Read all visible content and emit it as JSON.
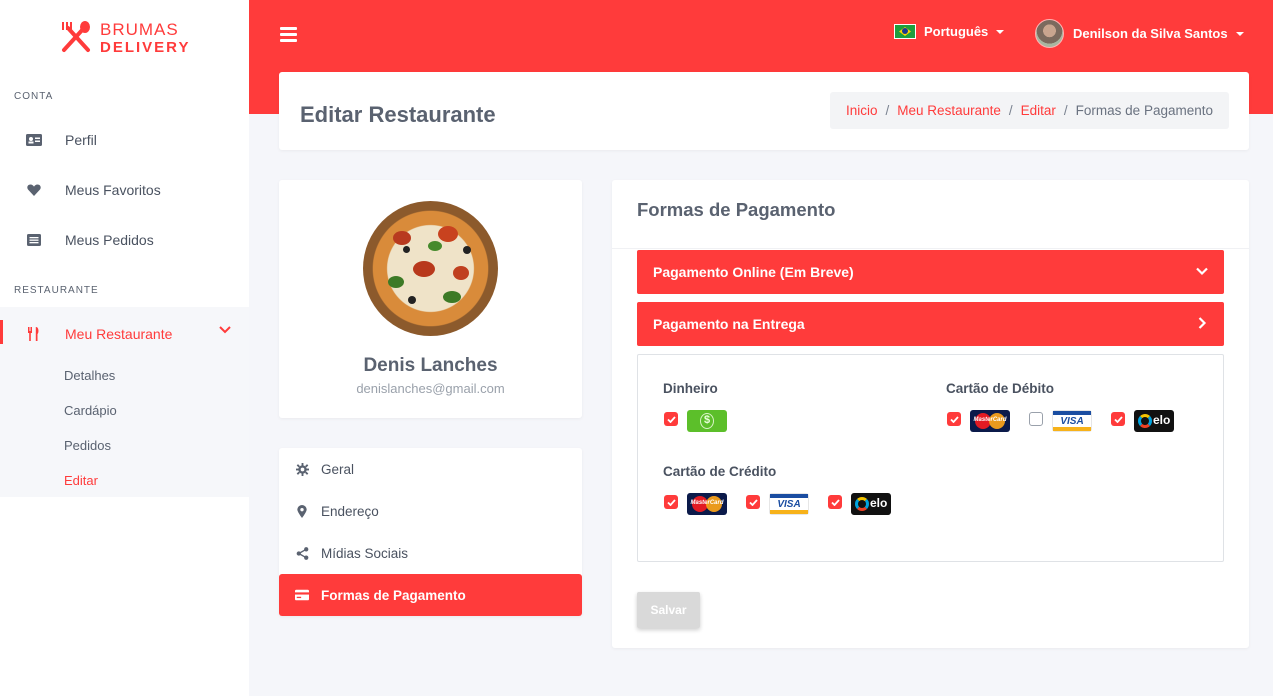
{
  "brand": {
    "line1": "BRUMAS",
    "line2": "DELIVERY"
  },
  "sidebar": {
    "section_account": "CONTA",
    "section_restaurant": "RESTAURANTE",
    "items": [
      {
        "label": "Perfil",
        "icon": "id-card-icon"
      },
      {
        "label": "Meus Favoritos",
        "icon": "heart-icon"
      },
      {
        "label": "Meus Pedidos",
        "icon": "list-icon"
      },
      {
        "label": "Meu Restaurante",
        "icon": "utensils-icon"
      }
    ],
    "subitems": [
      {
        "label": "Detalhes"
      },
      {
        "label": "Cardápio"
      },
      {
        "label": "Pedidos"
      },
      {
        "label": "Editar"
      }
    ]
  },
  "topbar": {
    "language": "Português",
    "user_name": "Denilson da Silva Santos"
  },
  "header": {
    "title": "Editar Restaurante",
    "breadcrumb": [
      "Inicio",
      "Meu Restaurante",
      "Editar",
      "Formas de Pagamento"
    ]
  },
  "profile": {
    "name": "Denis Lanches",
    "email": "denislanches@gmail.com"
  },
  "menu": {
    "items": [
      {
        "label": "Geral",
        "icon": "gear-icon"
      },
      {
        "label": "Endereço",
        "icon": "map-marker-icon"
      },
      {
        "label": "Mídias Sociais",
        "icon": "share-icon"
      },
      {
        "label": "Formas de Pagamento",
        "icon": "credit-card-icon"
      }
    ]
  },
  "payment": {
    "title": "Formas de Pagamento",
    "online_label": "Pagamento Online (Em Breve)",
    "delivery_label": "Pagamento na Entrega",
    "groups": {
      "cash": {
        "label": "Dinheiro",
        "checked": [
          true
        ]
      },
      "debit": {
        "label": "Cartão de Débito",
        "checked": [
          true,
          false,
          true
        ]
      },
      "credit": {
        "label": "Cartão de Crédito",
        "checked": [
          true,
          true,
          true
        ]
      }
    },
    "card_brands": {
      "mastercard": "MasterCard",
      "visa": "VISA",
      "elo": "elo",
      "cash": "$"
    },
    "save_label": "Salvar"
  },
  "colors": {
    "accent": "#ff3b3b",
    "sidebar_bg": "#ffffff",
    "page_bg": "#f5f6fa"
  }
}
